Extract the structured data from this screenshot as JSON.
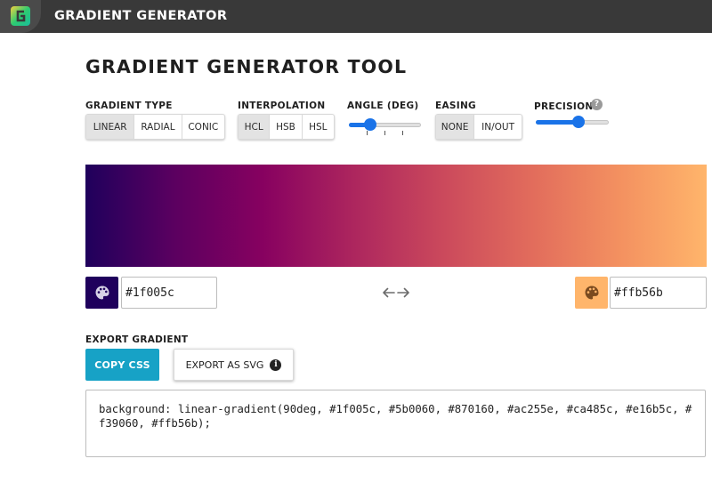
{
  "app": {
    "title": "GRADIENT GENERATOR",
    "logo_icon": "gradient-logo-icon"
  },
  "page_title": "GRADIENT GENERATOR TOOL",
  "controls": {
    "gradient_type": {
      "label": "GRADIENT TYPE",
      "options": [
        "LINEAR",
        "RADIAL",
        "CONIC"
      ],
      "selected": "LINEAR"
    },
    "interpolation": {
      "label": "INTERPOLATION",
      "options": [
        "HCL",
        "HSB",
        "HSL"
      ],
      "selected": "HCL"
    },
    "angle": {
      "label": "ANGLE (DEG)",
      "value": 90,
      "min": 0,
      "max": 360,
      "fraction": 0.25
    },
    "easing": {
      "label": "EASING",
      "options": [
        "NONE",
        "IN/OUT"
      ],
      "selected": "NONE"
    },
    "precision": {
      "label": "PRECISION",
      "help_icon": "question-circle-icon",
      "fraction": 0.6
    }
  },
  "gradient": {
    "angle": "90deg",
    "stops": [
      "#1f005c",
      "#5b0060",
      "#870160",
      "#ac255e",
      "#ca485c",
      "#e16b5c",
      "#f39060",
      "#ffb56b"
    ]
  },
  "color_start": {
    "hex": "#1f005c",
    "swatch_color": "#1f005c",
    "icon": "palette-icon"
  },
  "color_end": {
    "hex": "#ffb56b",
    "swatch_color": "#ffb56b",
    "icon": "palette-icon"
  },
  "swap_icon": "swap-arrows-icon",
  "export": {
    "label": "EXPORT GRADIENT",
    "copy_label": "COPY CSS",
    "svg_label": "EXPORT AS SVG",
    "info_icon": "info-circle-icon",
    "css_code": "background: linear-gradient(90deg, #1f005c, #5b0060, #870160, #ac255e, #ca485c, #e16b5c, #f39060, #ffb56b);"
  },
  "colors": {
    "topbar": "#393939",
    "accent_blue": "#1a73e8",
    "copy_button": "#17a2c6"
  }
}
